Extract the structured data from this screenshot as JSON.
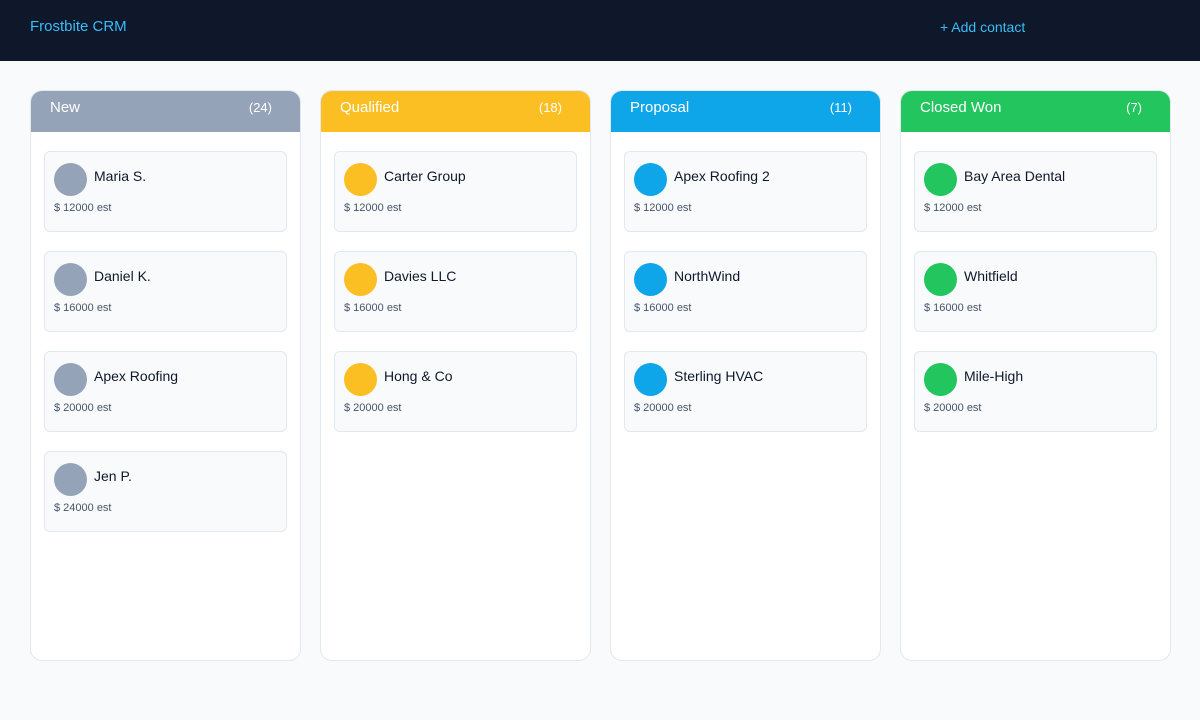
{
  "header": {
    "app_title": "Frostbite CRM",
    "add_contact_label": "+ Add contact"
  },
  "columns": [
    {
      "title": "New",
      "count": "(24)",
      "color": "#94a3b8",
      "cards": [
        {
          "name": "Maria S.",
          "value": "$ 12000 est"
        },
        {
          "name": "Daniel K.",
          "value": "$ 16000 est"
        },
        {
          "name": "Apex Roofing",
          "value": "$ 20000 est"
        },
        {
          "name": "Jen P.",
          "value": "$ 24000 est"
        }
      ]
    },
    {
      "title": "Qualified",
      "count": "(18)",
      "color": "#fbbf24",
      "cards": [
        {
          "name": "Carter Group",
          "value": "$ 12000 est"
        },
        {
          "name": "Davies LLC",
          "value": "$ 16000 est"
        },
        {
          "name": "Hong & Co",
          "value": "$ 20000 est"
        }
      ]
    },
    {
      "title": "Proposal",
      "count": "(11)",
      "color": "#0ea5e9",
      "cards": [
        {
          "name": "Apex Roofing 2",
          "value": "$ 12000 est"
        },
        {
          "name": "NorthWind",
          "value": "$ 16000 est"
        },
        {
          "name": "Sterling HVAC",
          "value": "$ 20000 est"
        }
      ]
    },
    {
      "title": "Closed Won",
      "count": "(7)",
      "color": "#22c55e",
      "cards": [
        {
          "name": "Bay Area Dental",
          "value": "$ 12000 est"
        },
        {
          "name": "Whitfield",
          "value": "$ 16000 est"
        },
        {
          "name": "Mile-High",
          "value": "$ 20000 est"
        }
      ]
    }
  ]
}
